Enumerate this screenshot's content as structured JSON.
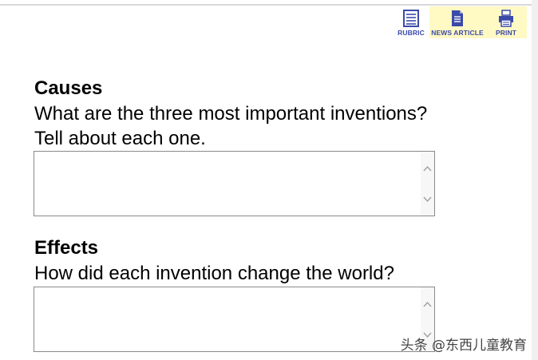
{
  "toolbar": {
    "rubric_label": "RUBRIC",
    "news_label": "NEWS ARTICLE",
    "print_label": "PRINT",
    "accent_color": "#3b4aa8",
    "highlight_color": "#fff9c4"
  },
  "causes": {
    "title": "Causes",
    "prompt_line1": "What are the three most important inventions?",
    "prompt_line2": "Tell about each one.",
    "answer_value": ""
  },
  "effects": {
    "title": "Effects",
    "prompt_line1": "How did each invention change the world?",
    "answer_value": ""
  },
  "watermark": {
    "text": "头条 @东西儿童教育"
  }
}
